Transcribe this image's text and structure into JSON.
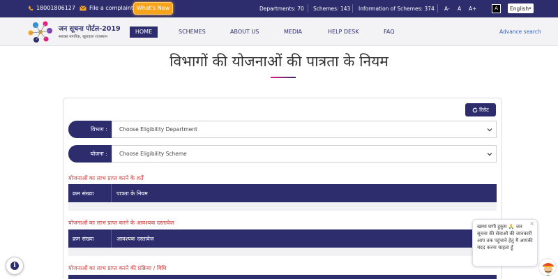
{
  "topbar": {
    "phone": "18001806127",
    "complaint": "File a complaint",
    "whats_new": "What's New",
    "departments": "Departments: 70",
    "schemes": "Schemes: 143",
    "info_schemes": "Information of Schemes: 374",
    "font_small": "A-",
    "font_normal": "A",
    "font_large": "A+",
    "contrast": "A",
    "language": "English"
  },
  "header": {
    "logo_title": "जन सूचना पोर्टल-2019",
    "logo_subtitle": "सशक्त नागरिक, खुशहाल राजस्थान",
    "nav": [
      "HOME",
      "SCHEMES",
      "ABOUT US",
      "MEDIA",
      "HELP DESK",
      "FAQ"
    ],
    "advance_search": "Advance search"
  },
  "page": {
    "title": "विभागों की योजनाओं की पात्रता के नियम",
    "reset": "रिसेट",
    "department_label": "विभाग :",
    "department_placeholder": "Choose Eligibility Department",
    "scheme_label": "योजना :",
    "scheme_placeholder": "Choose Eligibility Scheme",
    "sections": [
      {
        "title": "योजनाओं का लाभ प्राप्त करने के शर्तें",
        "col1": "क्रम संख्या",
        "col2": "पात्रता के नियम"
      },
      {
        "title": "योजनाओं का लाभ प्राप्त करने के आवश्यक दस्तावेज",
        "col1": "क्रम संख्या",
        "col2": "आवश्यक दस्तावेज"
      },
      {
        "title": "योजनाओं का लाभ प्राप्त करने की प्रक्रिया / विधि",
        "col1": "",
        "col2": ""
      }
    ]
  },
  "chat": {
    "message": "खम्मा घणी हुकुम 🙏 जन सूचना की सेवाओं की जानकारी आप तक पहुंचाने हेतु मैं आपकी मदद करना चाहता हूँ",
    "close": "×"
  },
  "colors": {
    "primary": "#2d2d6e",
    "accent": "#f7a41b",
    "section_title": "#d23a3a"
  }
}
